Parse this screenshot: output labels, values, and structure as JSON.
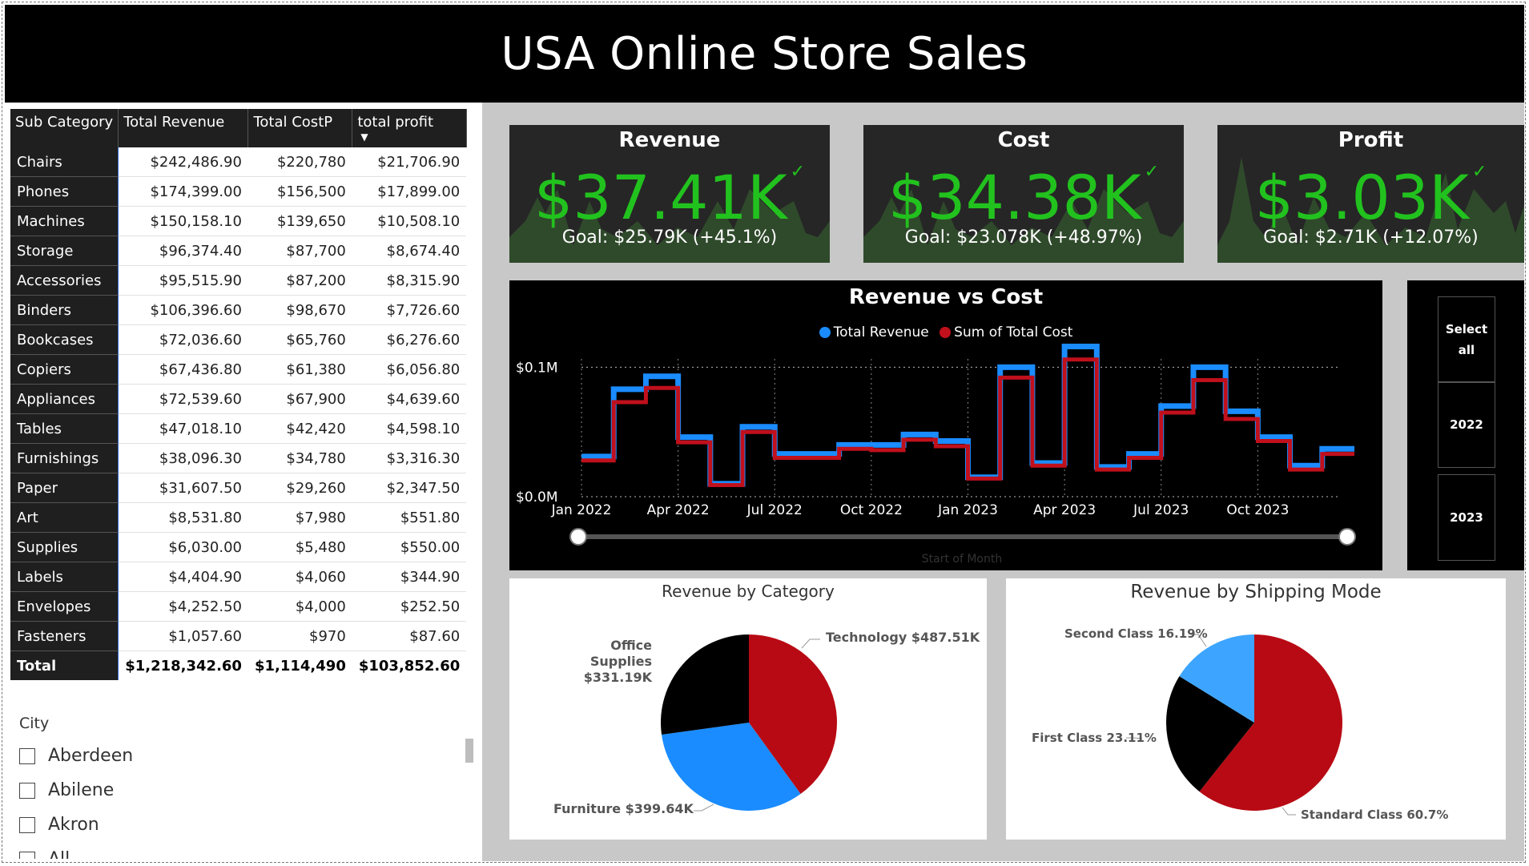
{
  "title": "USA Online Store Sales",
  "table": {
    "headers": [
      "Sub Category",
      "Total Revenue",
      "Total CostP",
      "total profit"
    ],
    "rows": [
      [
        "Chairs",
        "$242,486.90",
        "$220,780",
        "$21,706.90"
      ],
      [
        "Phones",
        "$174,399.00",
        "$156,500",
        "$17,899.00"
      ],
      [
        "Machines",
        "$150,158.10",
        "$139,650",
        "$10,508.10"
      ],
      [
        "Storage",
        "$96,374.40",
        "$87,700",
        "$8,674.40"
      ],
      [
        "Accessories",
        "$95,515.90",
        "$87,200",
        "$8,315.90"
      ],
      [
        "Binders",
        "$106,396.60",
        "$98,670",
        "$7,726.60"
      ],
      [
        "Bookcases",
        "$72,036.60",
        "$65,760",
        "$6,276.60"
      ],
      [
        "Copiers",
        "$67,436.80",
        "$61,380",
        "$6,056.80"
      ],
      [
        "Appliances",
        "$72,539.60",
        "$67,900",
        "$4,639.60"
      ],
      [
        "Tables",
        "$47,018.10",
        "$42,420",
        "$4,598.10"
      ],
      [
        "Furnishings",
        "$38,096.30",
        "$34,780",
        "$3,316.30"
      ],
      [
        "Paper",
        "$31,607.50",
        "$29,260",
        "$2,347.50"
      ],
      [
        "Art",
        "$8,531.80",
        "$7,980",
        "$551.80"
      ],
      [
        "Supplies",
        "$6,030.00",
        "$5,480",
        "$550.00"
      ],
      [
        "Labels",
        "$4,404.90",
        "$4,060",
        "$344.90"
      ],
      [
        "Envelopes",
        "$4,252.50",
        "$4,000",
        "$252.50"
      ],
      [
        "Fasteners",
        "$1,057.60",
        "$970",
        "$87.60"
      ]
    ],
    "total": [
      "Total",
      "$1,218,342.60",
      "$1,114,490",
      "$103,852.60"
    ]
  },
  "city_slicer": {
    "title": "City",
    "items": [
      "Aberdeen",
      "Abilene",
      "Akron",
      "All"
    ]
  },
  "kpis": [
    {
      "title": "Revenue",
      "value": "$37.41K",
      "goal": "Goal: $25.79K (+45.1%)"
    },
    {
      "title": "Cost",
      "value": "$34.38K",
      "goal": "Goal: $23.078K (+48.97%)"
    },
    {
      "title": "Profit",
      "value": "$3.03K",
      "goal": "Goal: $2.71K (+12.07%)"
    }
  ],
  "year_slicer": {
    "items": [
      "Select all",
      "2022",
      "2023"
    ]
  },
  "colors": {
    "revenue": "#1a8cff",
    "cost": "#c0101c",
    "kpi_green": "#22c21e",
    "furniture": "#1a8cff",
    "technology": "#b80a14",
    "office_supplies": "#000000"
  },
  "chart_data": [
    {
      "type": "line",
      "title": "Revenue vs Cost",
      "xlabel": "Start of Month",
      "ylabel": "",
      "x_ticks": [
        "Jan 2022",
        "Apr 2022",
        "Jul 2022",
        "Oct 2022",
        "Jan 2023",
        "Apr 2023",
        "Jul 2023",
        "Oct 2023"
      ],
      "y_ticks": [
        "$0.0M",
        "$0.1M"
      ],
      "ylim": [
        0,
        0.125
      ],
      "x": [
        "2022-01",
        "2022-02",
        "2022-03",
        "2022-04",
        "2022-05",
        "2022-06",
        "2022-07",
        "2022-08",
        "2022-09",
        "2022-10",
        "2022-11",
        "2022-12",
        "2023-01",
        "2023-02",
        "2023-03",
        "2023-04",
        "2023-05",
        "2023-06",
        "2023-07",
        "2023-08",
        "2023-09",
        "2023-10",
        "2023-11",
        "2023-12"
      ],
      "series": [
        {
          "name": "Total Revenue",
          "values": [
            0.031,
            0.083,
            0.093,
            0.046,
            0.01,
            0.054,
            0.033,
            0.033,
            0.04,
            0.04,
            0.048,
            0.043,
            0.015,
            0.1,
            0.026,
            0.116,
            0.023,
            0.033,
            0.07,
            0.1,
            0.066,
            0.046,
            0.024,
            0.037
          ]
        },
        {
          "name": "Sum of Total Cost",
          "values": [
            0.028,
            0.073,
            0.084,
            0.042,
            0.009,
            0.05,
            0.03,
            0.03,
            0.037,
            0.036,
            0.044,
            0.039,
            0.014,
            0.092,
            0.024,
            0.106,
            0.021,
            0.03,
            0.065,
            0.09,
            0.06,
            0.043,
            0.021,
            0.033
          ]
        }
      ]
    },
    {
      "type": "pie",
      "title": "Revenue by Category",
      "labels": [
        "Technology",
        "Furniture",
        "Office Supplies"
      ],
      "values": [
        487.51,
        399.64,
        331.19
      ],
      "label_texts": [
        "Technology $487.51K",
        "Furniture $399.64K",
        "Office Supplies",
        "$331.19K"
      ]
    },
    {
      "type": "pie",
      "title": "Revenue by Shipping Mode",
      "labels": [
        "Standard Class",
        "First Class",
        "Second Class"
      ],
      "values": [
        60.7,
        23.11,
        16.19
      ],
      "label_texts": [
        "Standard Class 60.7%",
        "First Class 23.11%",
        "Second Class 16.19%"
      ]
    }
  ]
}
